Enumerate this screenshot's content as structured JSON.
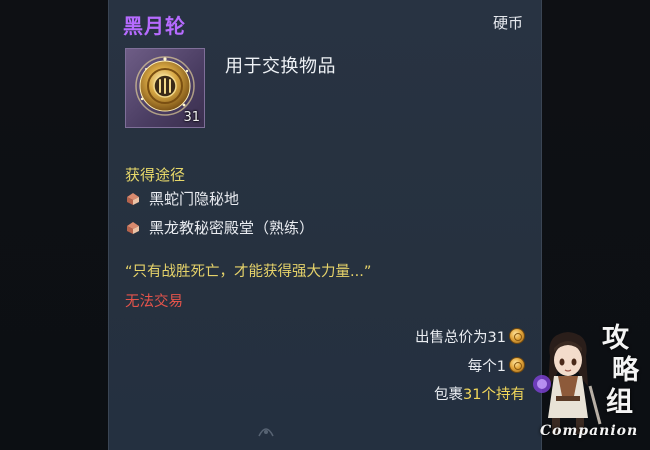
{
  "item": {
    "name": "黑月轮",
    "type": "硬币",
    "stack_count": "31",
    "description": "用于交换物品"
  },
  "acquisition": {
    "label": "获得途径",
    "sources": [
      {
        "name": "黑蛇门隐秘地",
        "icon": "chest-icon"
      },
      {
        "name": "黑龙教秘密殿堂（熟练）",
        "icon": "chest-icon"
      }
    ]
  },
  "flavor_text": "“只有战胜死亡，才能获得强大力量...”",
  "trade_status": "无法交易",
  "price": {
    "total_label": "出售总价为31",
    "unit_label": "每个1",
    "inventory_prefix": "包裹",
    "inventory_count": "31个持有"
  },
  "watermark": {
    "brand_cn_chars": [
      "攻",
      "略",
      "组"
    ],
    "brand_en": "Companion"
  },
  "colors": {
    "item_name": "#b66bff",
    "section_label": "#e7d86a",
    "flavor": "#e6d36a",
    "no_trade": "#e5544b",
    "panel_bg": "#283342"
  }
}
